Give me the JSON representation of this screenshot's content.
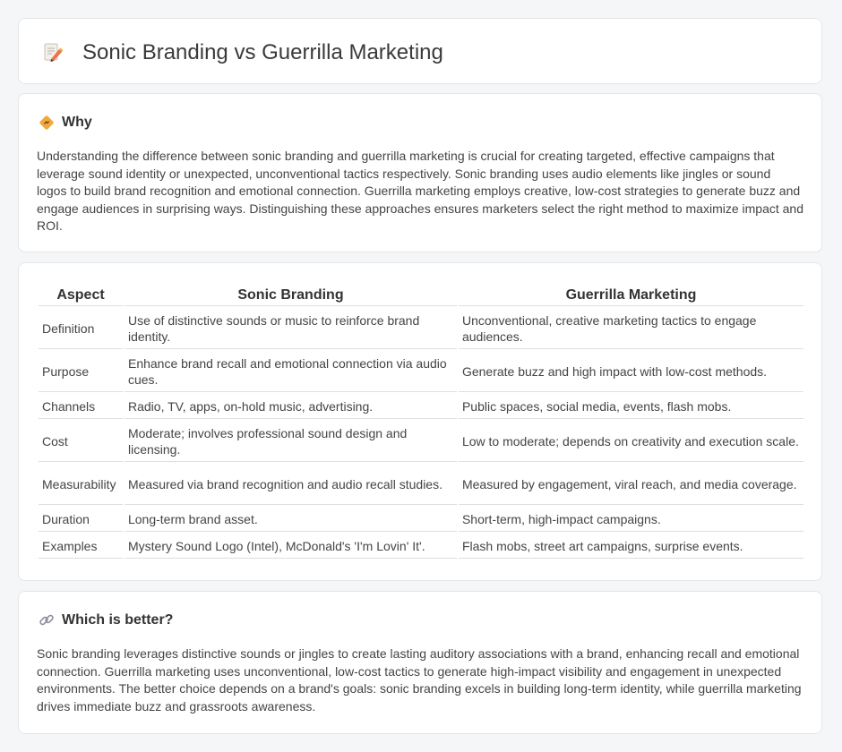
{
  "header": {
    "title": "Sonic Branding vs Guerrilla Marketing",
    "icon": "memo-pencil-icon"
  },
  "why": {
    "heading": "Why",
    "icon": "diamond-sign-icon",
    "text": "Understanding the difference between sonic branding and guerrilla marketing is crucial for creating targeted, effective campaigns that leverage sound identity or unexpected, unconventional tactics respectively. Sonic branding uses audio elements like jingles or sound logos to build brand recognition and emotional connection. Guerrilla marketing employs creative, low-cost strategies to generate buzz and engage audiences in surprising ways. Distinguishing these approaches ensures marketers select the right method to maximize impact and ROI."
  },
  "table": {
    "headers": [
      "Aspect",
      "Sonic Branding",
      "Guerrilla Marketing"
    ],
    "rows": [
      [
        "Definition",
        "Use of distinctive sounds or music to reinforce brand identity.",
        "Unconventional, creative marketing tactics to engage audiences."
      ],
      [
        "Purpose",
        "Enhance brand recall and emotional connection via audio cues.",
        "Generate buzz and high impact with low-cost methods."
      ],
      [
        "Channels",
        "Radio, TV, apps, on-hold music, advertising.",
        "Public spaces, social media, events, flash mobs."
      ],
      [
        "Cost",
        "Moderate; involves professional sound design and licensing.",
        "Low to moderate; depends on creativity and execution scale."
      ],
      [
        "Measurability",
        "Measured via brand recognition and audio recall studies.",
        "Measured by engagement, viral reach, and media coverage."
      ],
      [
        "Duration",
        "Long-term brand asset.",
        "Short-term, high-impact campaigns."
      ],
      [
        "Examples",
        "Mystery Sound Logo (Intel), McDonald's 'I'm Lovin' It'.",
        "Flash mobs, street art campaigns, surprise events."
      ]
    ]
  },
  "better": {
    "heading": "Which is better?",
    "icon": "link-icon",
    "text": "Sonic branding leverages distinctive sounds or jingles to create lasting auditory associations with a brand, enhancing recall and emotional connection. Guerrilla marketing uses unconventional, low-cost tactics to generate high-impact visibility and engagement in unexpected environments. The better choice depends on a brand's goals: sonic branding excels in building long-term identity, while guerrilla marketing drives immediate buzz and grassroots awareness."
  },
  "colors": {
    "background": "#f5f6f8",
    "card": "#ffffff",
    "border": "#e3e6ea",
    "accent_orange": "#f2a93b"
  }
}
